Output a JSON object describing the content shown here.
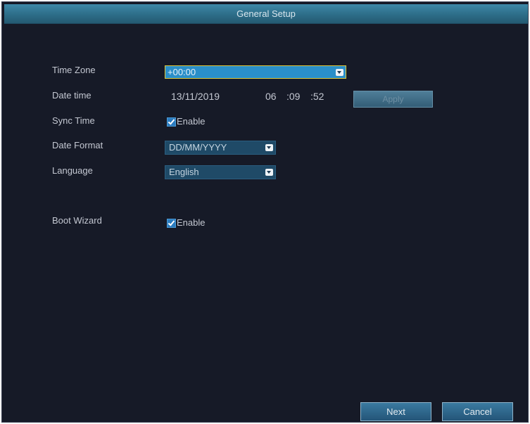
{
  "window": {
    "title": "General Setup"
  },
  "form": {
    "time_zone": {
      "label": "Time Zone",
      "value": "+00:00"
    },
    "date_time": {
      "label": "Date time",
      "date": "13/11/2019",
      "hour": "06",
      "minute": ":09",
      "second": ":52",
      "apply_label": "Apply"
    },
    "sync_time": {
      "label": "Sync Time",
      "checked": true,
      "checkbox_label": "Enable"
    },
    "date_format": {
      "label": "Date Format",
      "value": "DD/MM/YYYY"
    },
    "language": {
      "label": "Language",
      "value": "English"
    },
    "boot_wizard": {
      "label": "Boot Wizard",
      "checked": true,
      "checkbox_label": "Enable"
    }
  },
  "footer": {
    "next_label": "Next",
    "cancel_label": "Cancel"
  },
  "colors": {
    "background": "#161a27",
    "titlebar": "#2d6d88",
    "dropdown_selected": "#2a8fc9",
    "dropdown": "#1f4a67",
    "focus_border": "#e2c93a"
  },
  "icons": {
    "dropdown_arrow": "chevron-down-icon",
    "checkbox": "checkmark-icon"
  }
}
